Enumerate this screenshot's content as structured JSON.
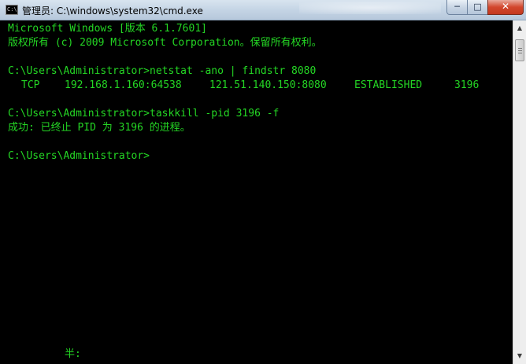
{
  "window": {
    "title": "管理员: C:\\windows\\system32\\cmd.exe",
    "icon_label": "C:\\",
    "buttons": {
      "minimize": "─",
      "maximize": "□",
      "close": "✕"
    }
  },
  "console": {
    "lines": [
      "Microsoft Windows [版本 6.1.7601]",
      "版权所有 (c) 2009 Microsoft Corporation。保留所有权利。",
      "",
      "C:\\Users\\Administrator>netstat -ano | findstr 8080",
      "",
      "",
      "C:\\Users\\Administrator>taskkill -pid 3196 -f",
      "成功: 已终止 PID 为 3196 的进程。",
      "",
      "C:\\Users\\Administrator>"
    ],
    "netstat_row": {
      "proto": "TCP",
      "local_address": "192.168.1.160:64538",
      "foreign_address": "121.51.140.150:8080",
      "state": "ESTABLISHED",
      "pid": "3196"
    },
    "ime_status": "半:"
  },
  "colors": {
    "console_text": "#24d624",
    "console_background": "#000000"
  },
  "icons": {
    "app": "cmd-icon",
    "scroll_up": "arrow-up-icon",
    "scroll_down": "arrow-down-icon"
  }
}
